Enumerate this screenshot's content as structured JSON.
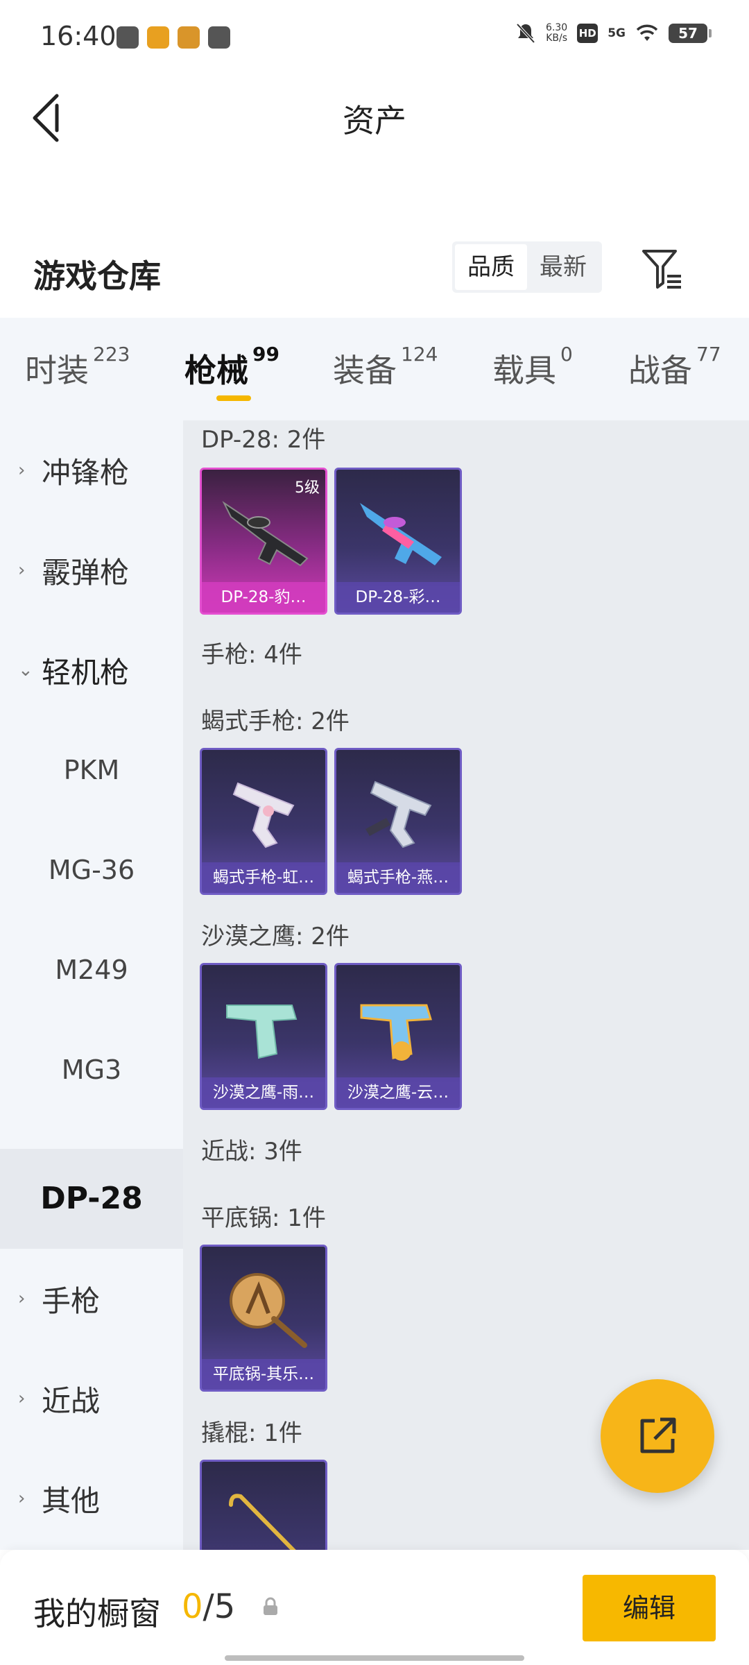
{
  "status": {
    "time": "16:40",
    "speed": "6.30",
    "speed_unit": "KB/s",
    "hd": "HD",
    "net": "5G",
    "battery": "57"
  },
  "header": {
    "title": "资产"
  },
  "section": {
    "title": "游戏仓库",
    "sort_quality": "品质",
    "sort_latest": "最新"
  },
  "tabs": [
    {
      "label": "时装",
      "count": "223"
    },
    {
      "label": "枪械",
      "count": "99"
    },
    {
      "label": "装备",
      "count": "124"
    },
    {
      "label": "载具",
      "count": "0"
    },
    {
      "label": "战备",
      "count": "77"
    }
  ],
  "sidebar": {
    "items": [
      {
        "label": "冲锋枪"
      },
      {
        "label": "霰弹枪"
      },
      {
        "label": "轻机枪"
      },
      {
        "label": "PKM"
      },
      {
        "label": "MG-36"
      },
      {
        "label": "M249"
      },
      {
        "label": "MG3"
      },
      {
        "label": "DP-28"
      },
      {
        "label": "手枪"
      },
      {
        "label": "近战"
      },
      {
        "label": "其他"
      }
    ]
  },
  "content": {
    "groups": [
      {
        "label": "DP-28: 2件"
      },
      {
        "label": "手枪: 4件"
      },
      {
        "label": "蝎式手枪: 2件"
      },
      {
        "label": "沙漠之鹰: 2件"
      },
      {
        "label": "近战: 3件"
      },
      {
        "label": "平底锅: 1件"
      },
      {
        "label": "撬棍: 1件"
      }
    ],
    "cards": [
      {
        "name": "DP-28-豹…",
        "level": "5级"
      },
      {
        "name": "DP-28-彩…"
      },
      {
        "name": "蝎式手枪-虹…"
      },
      {
        "name": "蝎式手枪-燕…"
      },
      {
        "name": "沙漠之鹰-雨…"
      },
      {
        "name": "沙漠之鹰-云…"
      },
      {
        "name": "平底锅-其乐…"
      }
    ]
  },
  "bottom": {
    "title": "我的橱窗",
    "current": "0",
    "total": "/5",
    "edit_label": "编辑"
  },
  "colors": {
    "accent": "#f7b800",
    "legendary": "#e44fd0",
    "epic": "#6f5cc4"
  }
}
